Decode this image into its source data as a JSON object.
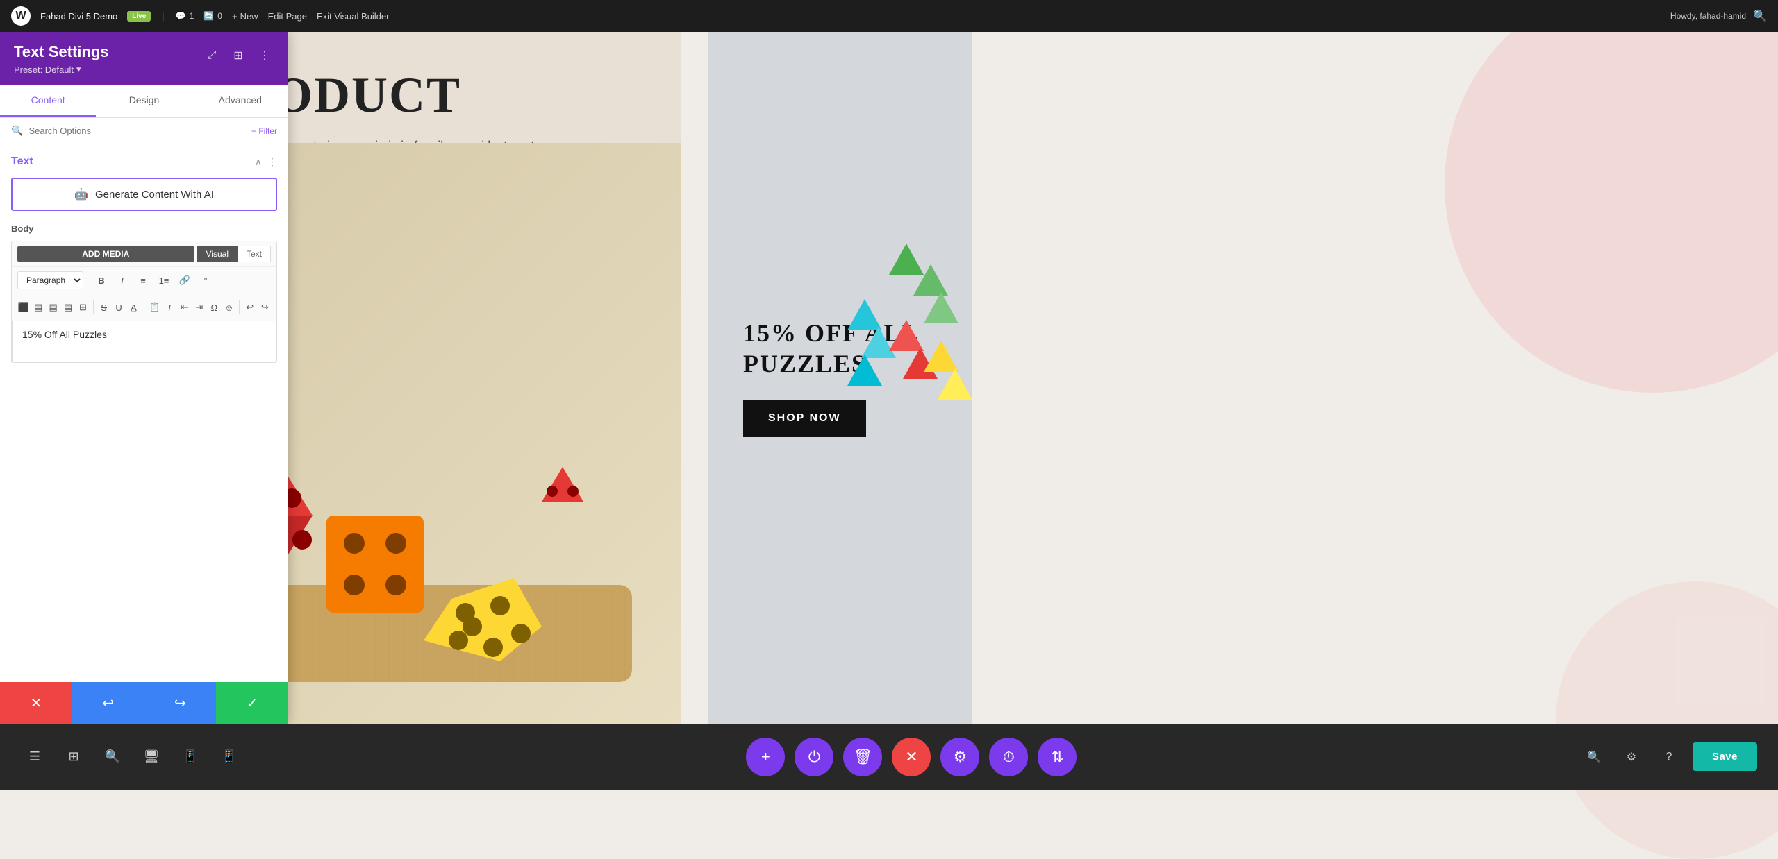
{
  "admin_bar": {
    "site_name": "Fahad Divi 5 Demo",
    "live_badge": "Live",
    "comments_count": "1",
    "items_count": "0",
    "new_label": "New",
    "edit_page_label": "Edit Page",
    "exit_vb_label": "Exit Visual Builder",
    "howdy_text": "Howdy, fahad-hamid"
  },
  "panel": {
    "title": "Text Settings",
    "preset_label": "Preset: Default",
    "tabs": [
      "Content",
      "Design",
      "Advanced"
    ],
    "active_tab": "Content",
    "search_placeholder": "Search Options",
    "filter_label": "+ Filter",
    "section_title": "Text",
    "ai_button_label": "Generate Content With AI",
    "body_label": "Body",
    "add_media_label": "ADD MEDIA",
    "visual_tab": "Visual",
    "text_tab": "Text",
    "paragraph_label": "Paragraph",
    "editor_content": "15% Off All Puzzles"
  },
  "panel_actions": {
    "cancel_icon": "✕",
    "undo_icon": "↩",
    "redo_icon": "↪",
    "save_icon": "✓"
  },
  "canvas": {
    "product_title": "D PRODUCT",
    "description": "et malesuada. Vestibulum ante ipsum primis in faucibus orci luctus et",
    "promo_title": "15% OFF ALL PUZZLES",
    "shop_btn": "SHOP NOW"
  },
  "bottom_bar": {
    "save_label": "Save"
  }
}
